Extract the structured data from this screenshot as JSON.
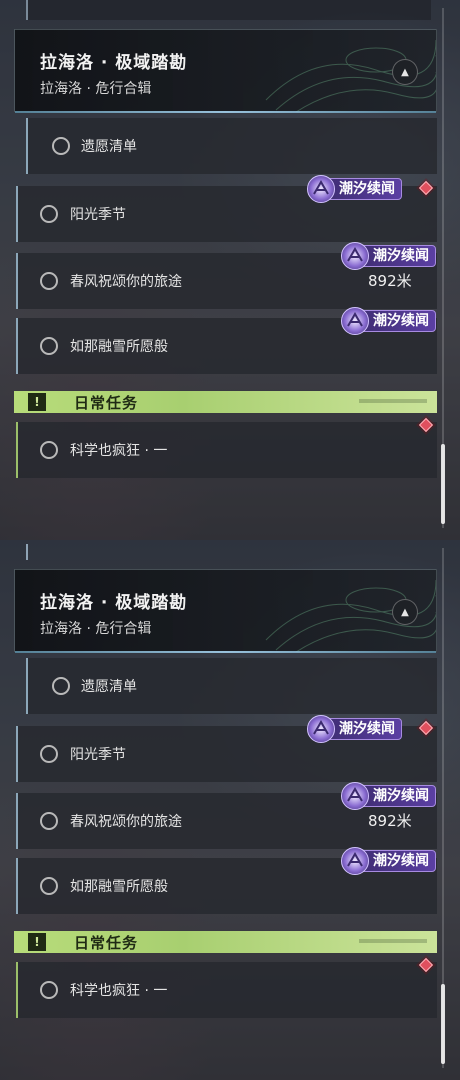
{
  "quest_group": {
    "title": "拉海洛 · 极域踏勘",
    "subtitle": "拉海洛 · 危行合辑"
  },
  "quests": [
    {
      "label": "遗愿清单",
      "badge": "",
      "distance": ""
    },
    {
      "label": "阳光季节",
      "badge": "潮汐续闻",
      "distance": ""
    },
    {
      "label": "春风祝颂你的旅途",
      "badge": "潮汐续闻",
      "distance": "892米"
    },
    {
      "label": "如那融雪所愿般",
      "badge": "潮汐续闻",
      "distance": ""
    }
  ],
  "daily": {
    "header": "日常任务",
    "icon": "!",
    "quests": [
      {
        "label": "科学也疯狂 · 一"
      }
    ]
  },
  "colors": {
    "badge_purple": "#5b3fa3",
    "daily_green": "#b8dc7a",
    "alert_red": "#e0505e"
  },
  "icons": [
    "chevron-up-icon",
    "tide-sequel-icon",
    "alert-diamond-icon",
    "exclamation-icon",
    "quest-circle-icon"
  ]
}
